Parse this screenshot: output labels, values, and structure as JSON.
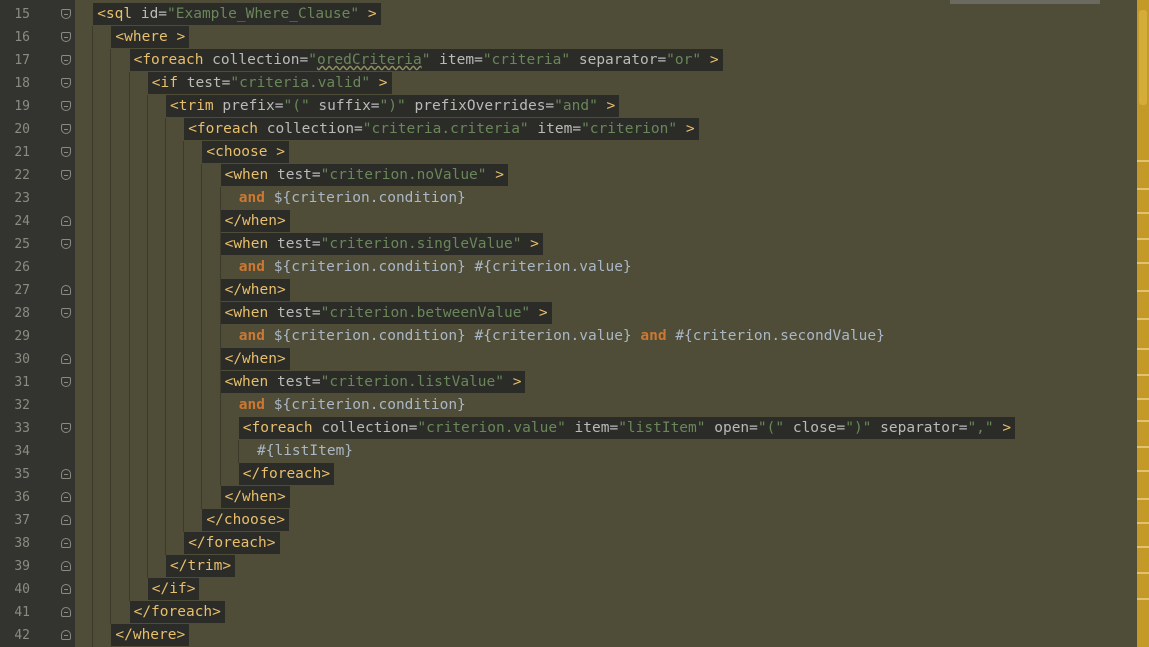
{
  "editor": {
    "lines": [
      {
        "num": "15",
        "segments": [
          [
            "tag",
            "<sql"
          ],
          [
            "attr",
            " id="
          ],
          [
            "val",
            "\"Example_Where_Clause\""
          ],
          [
            "tag",
            " >"
          ]
        ]
      },
      {
        "num": "16",
        "segments": [
          [
            "tag",
            "<where >"
          ]
        ]
      },
      {
        "num": "17",
        "segments": [
          [
            "tag",
            "<foreach"
          ],
          [
            "attr",
            " collection="
          ],
          [
            "val",
            "\""
          ],
          [
            "valsq",
            "oredCriteria"
          ],
          [
            "val",
            "\""
          ],
          [
            "attr",
            " item="
          ],
          [
            "val",
            "\"criteria\""
          ],
          [
            "attr",
            " separator="
          ],
          [
            "val",
            "\"or\""
          ],
          [
            "tag",
            " >"
          ]
        ]
      },
      {
        "num": "18",
        "segments": [
          [
            "tag",
            "<if"
          ],
          [
            "attr",
            " test="
          ],
          [
            "val",
            "\"criteria.valid\""
          ],
          [
            "tag",
            " >"
          ]
        ]
      },
      {
        "num": "19",
        "segments": [
          [
            "tag",
            "<trim"
          ],
          [
            "attr",
            " prefix="
          ],
          [
            "val",
            "\"(\""
          ],
          [
            "attr",
            " suffix="
          ],
          [
            "val",
            "\")\""
          ],
          [
            "attr",
            " prefixOverrides="
          ],
          [
            "val",
            "\"and\""
          ],
          [
            "tag",
            " >"
          ]
        ]
      },
      {
        "num": "20",
        "segments": [
          [
            "tag",
            "<foreach"
          ],
          [
            "attr",
            " collection="
          ],
          [
            "val",
            "\"criteria.criteria\""
          ],
          [
            "attr",
            " item="
          ],
          [
            "val",
            "\"criterion\""
          ],
          [
            "tag",
            " >"
          ]
        ]
      },
      {
        "num": "21",
        "segments": [
          [
            "tag",
            "<choose >"
          ]
        ]
      },
      {
        "num": "22",
        "segments": [
          [
            "tag",
            "<when"
          ],
          [
            "attr",
            " test="
          ],
          [
            "val",
            "\"criterion.noValue\""
          ],
          [
            "tag",
            " >"
          ]
        ]
      },
      {
        "num": "23",
        "segments": [
          [
            "kw",
            "and"
          ],
          [
            "txt",
            " ${criterion.condition}"
          ]
        ]
      },
      {
        "num": "24",
        "segments": [
          [
            "tag",
            "</when>"
          ]
        ]
      },
      {
        "num": "25",
        "segments": [
          [
            "tag",
            "<when"
          ],
          [
            "attr",
            " test="
          ],
          [
            "val",
            "\"criterion.singleValue\""
          ],
          [
            "tag",
            " >"
          ]
        ]
      },
      {
        "num": "26",
        "segments": [
          [
            "kw",
            "and"
          ],
          [
            "txt",
            " ${criterion.condition} #{criterion.value}"
          ]
        ]
      },
      {
        "num": "27",
        "segments": [
          [
            "tag",
            "</when>"
          ]
        ]
      },
      {
        "num": "28",
        "segments": [
          [
            "tag",
            "<when"
          ],
          [
            "attr",
            " test="
          ],
          [
            "val",
            "\"criterion.betweenValue\""
          ],
          [
            "tag",
            " >"
          ]
        ]
      },
      {
        "num": "29",
        "segments": [
          [
            "kw",
            "and"
          ],
          [
            "txt",
            " ${criterion.condition} #{criterion.value} "
          ],
          [
            "kw",
            "and"
          ],
          [
            "txt",
            " #{criterion.secondValue}"
          ]
        ]
      },
      {
        "num": "30",
        "segments": [
          [
            "tag",
            "</when>"
          ]
        ]
      },
      {
        "num": "31",
        "segments": [
          [
            "tag",
            "<when"
          ],
          [
            "attr",
            " test="
          ],
          [
            "val",
            "\"criterion.listValue\""
          ],
          [
            "tag",
            " >"
          ]
        ]
      },
      {
        "num": "32",
        "segments": [
          [
            "kw",
            "and"
          ],
          [
            "txt",
            " ${criterion.condition}"
          ]
        ]
      },
      {
        "num": "33",
        "segments": [
          [
            "tag",
            "<foreach"
          ],
          [
            "attr",
            " collection="
          ],
          [
            "val",
            "\"criterion.value\""
          ],
          [
            "attr",
            " item="
          ],
          [
            "val",
            "\"listItem\""
          ],
          [
            "attr",
            " open="
          ],
          [
            "val",
            "\"(\""
          ],
          [
            "attr",
            " close="
          ],
          [
            "val",
            "\")\""
          ],
          [
            "attr",
            " separator="
          ],
          [
            "val",
            "\",\""
          ],
          [
            "tag",
            " >"
          ]
        ]
      },
      {
        "num": "34",
        "segments": [
          [
            "txt",
            "#{listItem}"
          ]
        ]
      },
      {
        "num": "35",
        "segments": [
          [
            "tag",
            "</foreach>"
          ]
        ]
      },
      {
        "num": "36",
        "segments": [
          [
            "tag",
            "</when>"
          ]
        ]
      },
      {
        "num": "37",
        "segments": [
          [
            "tag",
            "</choose>"
          ]
        ]
      },
      {
        "num": "38",
        "segments": [
          [
            "tag",
            "</foreach>"
          ]
        ]
      },
      {
        "num": "39",
        "segments": [
          [
            "tag",
            "</trim>"
          ]
        ]
      },
      {
        "num": "40",
        "segments": [
          [
            "tag",
            "</if>"
          ]
        ]
      },
      {
        "num": "41",
        "segments": [
          [
            "tag",
            "</foreach>"
          ]
        ]
      },
      {
        "num": "42",
        "segments": [
          [
            "tag",
            "</where>"
          ]
        ]
      }
    ]
  },
  "colors": {
    "background": "#514d38",
    "tag": "#e8bf6a",
    "attribute": "#bababa",
    "string": "#6a8759",
    "keyword": "#cc7832",
    "text": "#a9b7c6",
    "scrollbar": "#c39a28"
  }
}
